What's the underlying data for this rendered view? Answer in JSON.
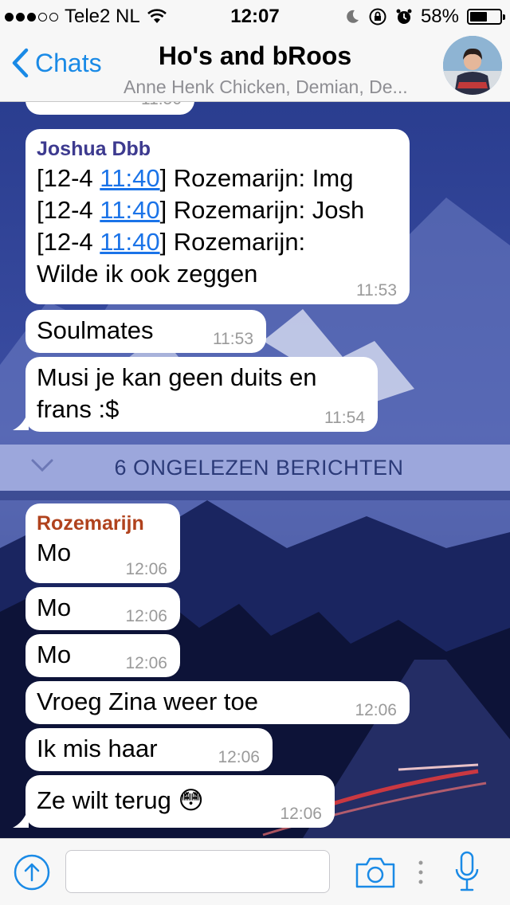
{
  "status_bar": {
    "carrier": "Tele2 NL",
    "time": "12:07",
    "battery": "58%",
    "battery_level": 0.58
  },
  "nav": {
    "back_label": "Chats",
    "title": "Ho's and bRoos",
    "subtitle": "Anne Henk Chicken, Demian, De..."
  },
  "colors": {
    "accent": "#1a8ae6",
    "sender_joshua": "#3d3a8f",
    "sender_rozemarijn": "#b0421d",
    "link": "#1a73e8",
    "unread_bar": "#aab4e6"
  },
  "messages_top": {
    "partial_ts": "11:50",
    "m1": {
      "sender": "Joshua Dbb",
      "lines": [
        {
          "pre": "[12-4 ",
          "link": "11:40",
          "post": "] Rozemarijn: Img"
        },
        {
          "pre": "[12-4 ",
          "link": "11:40",
          "post": "] Rozemarijn: Josh"
        },
        {
          "pre": "[12-4 ",
          "link": "11:40",
          "post": "] Rozemarijn:"
        }
      ],
      "last_line": "Wilde ik ook zeggen",
      "time": "11:53"
    },
    "m2": {
      "text": "Soulmates",
      "time": "11:53"
    },
    "m3": {
      "line1": "Musi je kan geen duits en",
      "line2": "frans :$",
      "time": "11:54"
    }
  },
  "unread_label": "6 ONGELEZEN BERICHTEN",
  "messages_bottom": {
    "sender": "Rozemarijn",
    "m1": {
      "text": "Mo",
      "time": "12:06"
    },
    "m2": {
      "text": "Mo",
      "time": "12:06"
    },
    "m3": {
      "text": "Mo",
      "time": "12:06"
    },
    "m4": {
      "text": "Vroeg Zina weer toe",
      "time": "12:06"
    },
    "m5": {
      "text": "Ik mis haar",
      "time": "12:06"
    },
    "m6": {
      "text": "Ze wilt terug",
      "emoji": "😳",
      "time": "12:06"
    }
  },
  "input": {
    "value": "",
    "icons": [
      "upload-arrow-icon",
      "camera-icon",
      "more-dots-icon",
      "microphone-icon"
    ]
  }
}
